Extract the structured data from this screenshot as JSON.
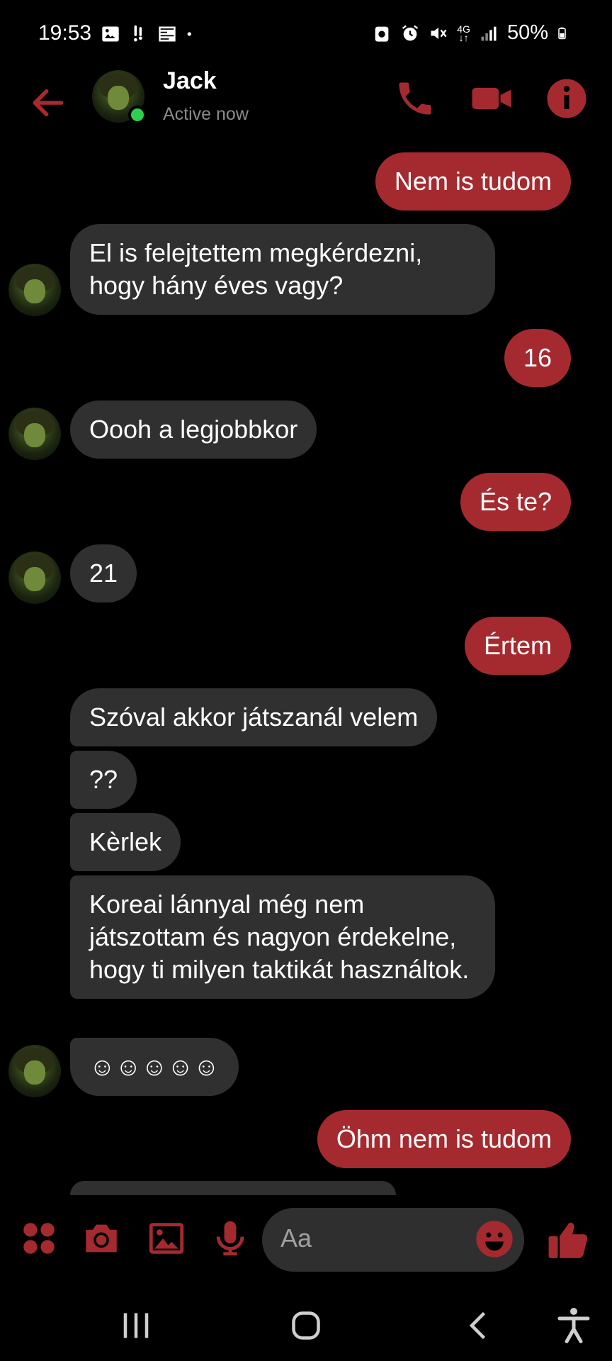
{
  "status_bar": {
    "time": "19:53",
    "battery_percent": "50%",
    "network": "4G",
    "icons": [
      "image-icon",
      "notification-icon",
      "news-icon",
      "dot-icon",
      "lock-battery-icon",
      "alarm-icon",
      "mute-icon",
      "network-4g-icon",
      "signal-icon",
      "battery-icon"
    ]
  },
  "header": {
    "contact_name": "Jack",
    "contact_status": "Active now",
    "icons": [
      "back-arrow-icon",
      "phone-icon",
      "video-camera-icon",
      "info-icon"
    ]
  },
  "messages": [
    {
      "side": "out",
      "text": "Nem is tudom"
    },
    {
      "side": "in",
      "text": "El is felejtettem megkérdezni, hogy hány éves vagy?"
    },
    {
      "side": "out",
      "text": "16"
    },
    {
      "side": "in",
      "text": "Oooh a legjobbkor"
    },
    {
      "side": "out",
      "text": "És te?"
    },
    {
      "side": "in",
      "text": "21"
    },
    {
      "side": "out",
      "text": "Értem"
    },
    {
      "side": "in",
      "text": "Szóval akkor játszanál velem"
    },
    {
      "side": "in",
      "text": "??"
    },
    {
      "side": "in",
      "text": "Kèrlek"
    },
    {
      "side": "in",
      "text": "Koreai lánnyal még nem játszottam és nagyon érdekelne, hogy ti milyen taktikát használtok."
    },
    {
      "side": "in",
      "text": "☺☺☺☺☺"
    },
    {
      "side": "out",
      "text": "Öhm nem is tudom"
    }
  ],
  "composer": {
    "placeholder": "Aa",
    "icons": [
      "menu-dots-icon",
      "camera-icon",
      "gallery-icon",
      "microphone-icon",
      "emoji-icon",
      "thumbs-up-icon"
    ]
  },
  "nav_bar": {
    "icons": [
      "recent-apps-icon",
      "home-icon",
      "back-icon",
      "accessibility-icon"
    ]
  },
  "colors": {
    "accent": "#a52a2f",
    "incoming_bubble": "#303030",
    "background": "#000000",
    "online": "#2fcd4e"
  }
}
